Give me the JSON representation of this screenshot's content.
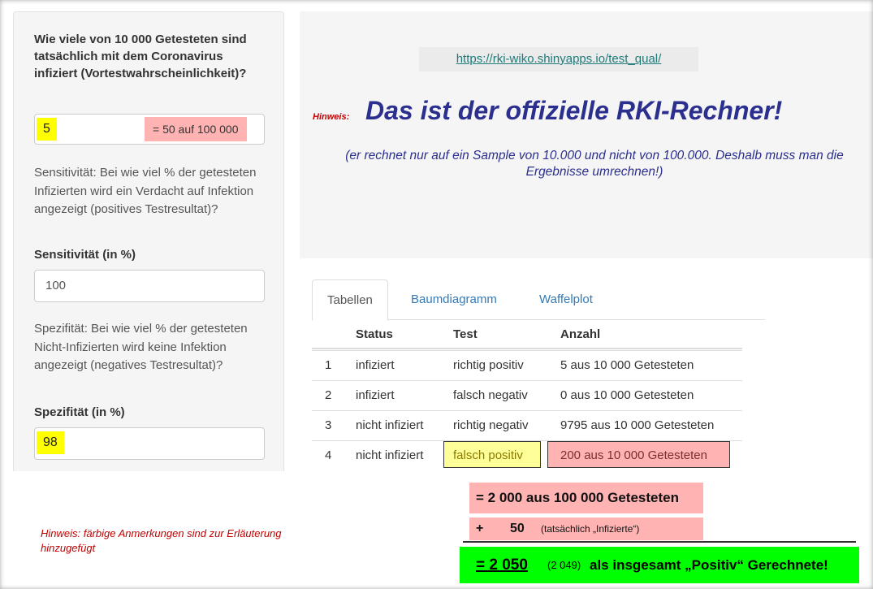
{
  "sidebar": {
    "question": "Wie viele von 10 000 Getesteten sind tatsächlich mit dem Coronavirus infiziert (Vortestwahrscheinlichkeit)?",
    "prevalence_value": "5",
    "prevalence_note": "= 50 auf 100 000",
    "sens_help": "Sensitivität: Bei wie viel % der getesteten Infizierten wird ein Verdacht auf Infektion angezeigt (positives Testresultat)?",
    "sens_label": "Sensitivität (in %)",
    "sens_value": "100",
    "spec_help": "Spezifität: Bei wie viel % der getesteten Nicht-Infizierten wird keine Infektion angezeigt (negatives Testresultat)?",
    "spec_label": "Spezifität (in %)",
    "spec_value": "98"
  },
  "info": {
    "url": "https://rki-wiko.shinyapps.io/test_qual/",
    "hinweis": "Hinweis:",
    "headline": "Das ist der offizielle RKI-Rechner!",
    "subnote": "(er rechnet nur auf ein Sample von 10.000 und nicht von 100.000. Deshalb muss man die Ergebnisse umrechnen!)"
  },
  "tabs": [
    "Tabellen",
    "Baumdiagramm",
    "Waffelplot"
  ],
  "table": {
    "headers": [
      "",
      "Status",
      "Test",
      "Anzahl"
    ],
    "rows": [
      [
        "1",
        "infiziert",
        "richtig positiv",
        "5 aus 10 000 Getesteten"
      ],
      [
        "2",
        "infiziert",
        "falsch negativ",
        "0 aus 10 000 Getesteten"
      ],
      [
        "3",
        "nicht infiziert",
        "richtig negativ",
        "9795 aus 10 000 Getesteten"
      ],
      [
        "4",
        "nicht infiziert",
        "falsch positiv",
        "200 aus 10 000 Getesteten"
      ]
    ]
  },
  "annotations": {
    "hint_bottom": "Hinweis: färbige Anmerkungen sind zur Erläuterung hinzugefügt",
    "calc_line1": "= 2 000 aus 100 000 Getesteten",
    "calc_plus": "+",
    "calc_plus_num": "50",
    "calc_plus_note": "(tatsächlich „Infizierte“)",
    "result_big": "= 2 050",
    "result_paren": "(2 049)",
    "result_rest": "als insgesamt „Positiv“ Gerechnete!"
  },
  "colors": {
    "highlight_yellow": "#ffff00",
    "highlight_pink": "#ffb3b3",
    "result_green": "#00ff00",
    "headline_blue": "#2b2f8e",
    "hint_red": "#c00000",
    "link_teal": "#1f7a7a"
  }
}
